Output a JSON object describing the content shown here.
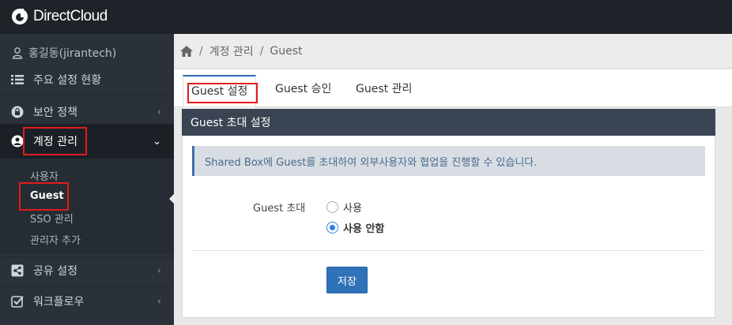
{
  "app": {
    "logo_text": "DirectCloud"
  },
  "sidebar": {
    "user": "홍길동(jirantech)",
    "status": "주요 설정 현황",
    "items": [
      {
        "label": "보안 정책",
        "icon": "lock-icon"
      },
      {
        "label": "계정 관리",
        "icon": "user-circle-icon"
      },
      {
        "label": "공유 설정",
        "icon": "share-icon"
      },
      {
        "label": "워크플로우",
        "icon": "check-square-icon"
      }
    ],
    "submenu": [
      "사용자",
      "Guest",
      "SSO 관리",
      "관리자 추가"
    ]
  },
  "breadcrumb": {
    "items": [
      "계정 관리",
      "Guest"
    ],
    "sep": "/"
  },
  "tabs": [
    "Guest 설정",
    "Guest 승인",
    "Guest 관리"
  ],
  "panel": {
    "title": "Guest 초대 설정",
    "alert": "Shared Box에 Guest를 초대하여 외부사용자와 협업을 진행할 수 있습니다.",
    "field_label": "Guest 초대",
    "options": [
      "사용",
      "사용 안함"
    ],
    "selected": "사용 안함",
    "save_label": "저장"
  },
  "colors": {
    "accent": "#3072b8",
    "highlight": "#e21b1b",
    "sidebar": "#2a3138"
  }
}
